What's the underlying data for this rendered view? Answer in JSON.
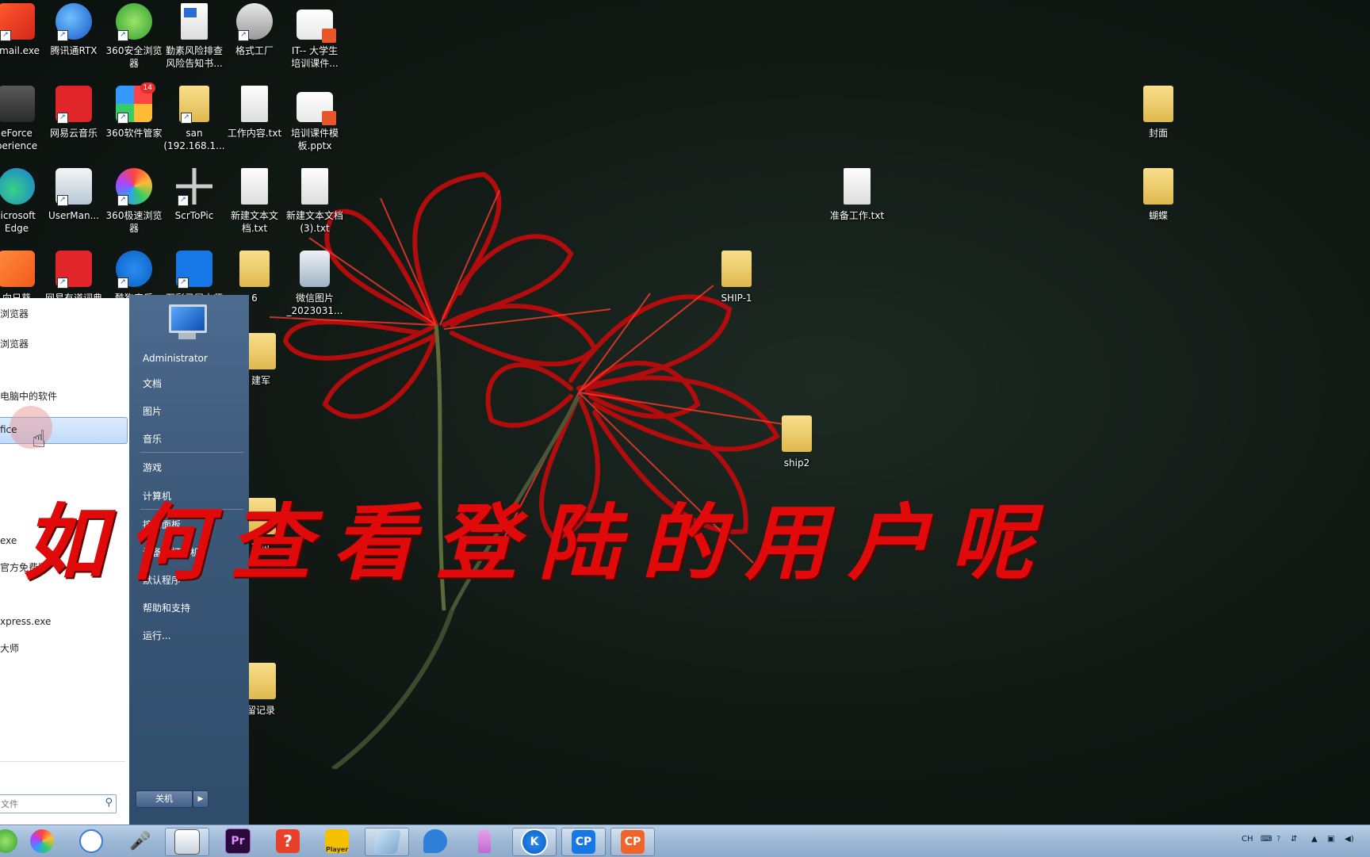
{
  "desktop": {
    "icons": [
      {
        "label": "xmail.exe",
        "icon": "xmail-icon"
      },
      {
        "label": "腾讯通RTX",
        "icon": "rtx-icon"
      },
      {
        "label": "360安全浏览\n器",
        "icon": "browser-360-icon"
      },
      {
        "label": "勤素风险排查\n风险告知书...",
        "icon": "word-doc-icon"
      },
      {
        "label": "格式工厂",
        "icon": "format-factory-icon"
      },
      {
        "label": "IT-- 大学生\n培训课件...",
        "icon": "pptx-icon"
      },
      {
        "label": "eForce\nperience",
        "icon": "geforce-icon"
      },
      {
        "label": "网易云音乐",
        "icon": "netease-music-icon"
      },
      {
        "label": "360软件管家",
        "icon": "software-manager-icon",
        "badge": "14"
      },
      {
        "label": "san\n(192.168.1...",
        "icon": "network-folder-icon"
      },
      {
        "label": "工作内容.txt",
        "icon": "text-file-icon"
      },
      {
        "label": "培训课件模\n板.pptx",
        "icon": "pptx-icon"
      },
      {
        "label": "licrosoft\nEdge",
        "icon": "edge-icon"
      },
      {
        "label": "UserMan...",
        "icon": "userman-icon"
      },
      {
        "label": "360极速浏览\n器",
        "icon": "chrome-360-icon"
      },
      {
        "label": "ScrToPic",
        "icon": "scrtopic-icon"
      },
      {
        "label": "新建文本文\n档.txt",
        "icon": "text-file-icon"
      },
      {
        "label": "新建文本文档\n(3).txt",
        "icon": "text-file-icon"
      },
      {
        "label": "向日葵",
        "icon": "sunflower-icon"
      },
      {
        "label": "网易有道词典",
        "icon": "youdao-icon"
      },
      {
        "label": "酷狗音乐",
        "icon": "kugou-icon"
      },
      {
        "label": "万彩录屏大师",
        "icon": "cp-recorder-icon"
      },
      {
        "label": "6",
        "icon": "folder-icon"
      },
      {
        "label": "微信图片\n_2023031...",
        "icon": "image-file-icon"
      },
      {
        "label": "SHIP-1",
        "icon": "folder-icon"
      },
      {
        "label": "建军",
        "icon": "folder-icon"
      },
      {
        "label": "ship2",
        "icon": "folder-icon"
      },
      {
        "label": "大贵",
        "icon": "folder-icon"
      },
      {
        "label": "留记录",
        "icon": "folder-icon"
      },
      {
        "label": "准备工作.txt",
        "icon": "text-file-icon"
      },
      {
        "label": "封面",
        "icon": "folder-icon"
      },
      {
        "label": "蝴蝶",
        "icon": "folder-icon"
      }
    ],
    "overlay_title": [
      "如",
      "何",
      "查",
      "看",
      "登",
      "陆",
      "的",
      "用",
      "户",
      "呢"
    ]
  },
  "start_menu": {
    "left_items": [
      "浏览器",
      "浏览器",
      "电脑中的软件",
      "fice",
      "",
      "",
      "exe",
      "官方免费版",
      "xpress.exe",
      "大师",
      ""
    ],
    "search_placeholder": "文件",
    "user_name": "Administrator",
    "right_items": [
      "文档",
      "图片",
      "音乐",
      "游戏",
      "计算机",
      "控制面板",
      "设备和打印机",
      "默认程序",
      "帮助和支持",
      "运行..."
    ],
    "shutdown_label": "关机"
  },
  "taskbar": {
    "apps": [
      {
        "name": "360-browser",
        "icon": "browser-360-icon"
      },
      {
        "name": "360-speed-browser",
        "icon": "chrome-360-icon"
      },
      {
        "name": "network",
        "icon": "network-icon"
      },
      {
        "name": "microphone",
        "icon": "microphone-icon"
      },
      {
        "name": "window",
        "icon": "window-icon"
      },
      {
        "name": "premiere",
        "icon": "premiere-icon",
        "text": "Pr"
      },
      {
        "name": "help",
        "icon": "help-icon",
        "text": "?"
      },
      {
        "name": "player",
        "icon": "player-icon",
        "text": "Player"
      },
      {
        "name": "notepad",
        "icon": "notepad-icon"
      },
      {
        "name": "bird",
        "icon": "bird-icon"
      },
      {
        "name": "podcast",
        "icon": "podcast-icon"
      },
      {
        "name": "kugou",
        "icon": "kugou-icon",
        "text": "K"
      },
      {
        "name": "cp-recorder",
        "icon": "cp-recorder-icon",
        "text": "CP"
      },
      {
        "name": "cp-orange",
        "icon": "cp-orange-icon",
        "text": "CP"
      }
    ],
    "tray": {
      "lang": "CH"
    }
  },
  "colors": {
    "overlay_text": "#e10a0a",
    "start_menu_right": "#3b5878",
    "taskbar": "#9db8d6"
  }
}
